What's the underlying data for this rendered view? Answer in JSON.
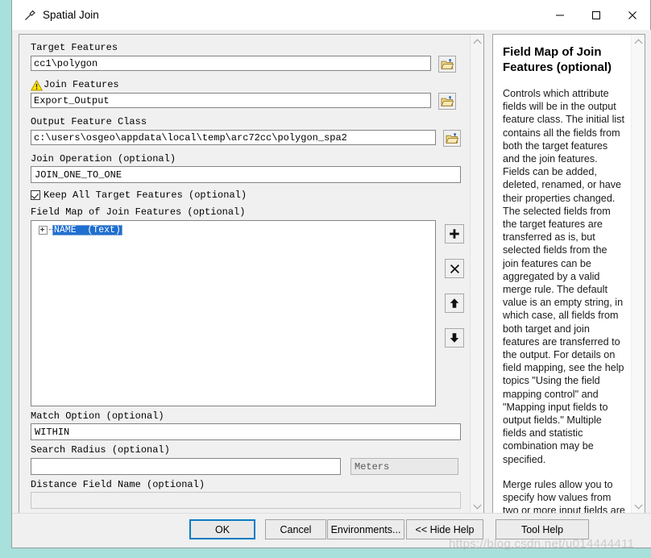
{
  "window": {
    "title": "Spatial Join",
    "icon": "hammer-icon",
    "controls": {
      "minimize": "─",
      "maximize": "□",
      "close": "✕"
    }
  },
  "params": {
    "target_features": {
      "label": "Target Features",
      "value": "cc1\\polygon",
      "browse": "folder-open-icon"
    },
    "join_features": {
      "label": "Join Features",
      "value": "Export_Output",
      "warning": "warning-icon",
      "browse": "folder-open-icon"
    },
    "output_feature_class": {
      "label": "Output Feature Class",
      "value": "c:\\users\\osgeo\\appdata\\local\\temp\\arc72cc\\polygon_spa2",
      "browse": "folder-open-icon"
    },
    "join_operation": {
      "label": "Join Operation (optional)",
      "value": "JOIN_ONE_TO_ONE"
    },
    "keep_all_target_features": {
      "label": "Keep All Target Features (optional)",
      "checked": true
    },
    "field_map": {
      "label": "Field Map of Join Features (optional)",
      "items": [
        {
          "name": "NAME  (Text)",
          "selected": true,
          "expandable": true
        }
      ],
      "buttons": [
        {
          "name": "add-field-button",
          "glyph": "+"
        },
        {
          "name": "delete-field-button",
          "glyph": "✕"
        },
        {
          "name": "move-up-button",
          "glyph": "↑"
        },
        {
          "name": "move-down-button",
          "glyph": "↓"
        }
      ]
    },
    "match_option": {
      "label": "Match Option (optional)",
      "value": "WITHIN"
    },
    "search_radius": {
      "label": "Search Radius (optional)",
      "value": "",
      "units_value": "Meters",
      "units_disabled": true
    },
    "distance_field_name": {
      "label": "Distance Field Name (optional)",
      "value": "",
      "disabled": true
    }
  },
  "help": {
    "title": "Field Map of Join Features (optional)",
    "paragraphs": [
      "Controls which attribute fields will be in the output feature class. The initial list contains all the fields from both the target features and the join features. Fields can be added, deleted, renamed, or have their properties changed. The selected fields from the target features are transferred as is, but selected fields from the join features can be aggregated by a valid merge rule. The default value is an empty string, in which case, all fields from both target and join features are transferred to the output. For details on field mapping, see the help topics \"Using the field mapping control\" and \"Mapping input fields to output fields.\" Multiple fields and statistic combination may be specified.",
      "Merge rules allow you to specify how values from two or more input fields are merged or combined into a single output value. There"
    ]
  },
  "footer": {
    "buttons": [
      {
        "name": "ok-button",
        "label": "OK",
        "default": true
      },
      {
        "name": "cancel-button",
        "label": "Cancel",
        "default": false
      },
      {
        "name": "environments-button",
        "label": "Environments...",
        "default": false
      },
      {
        "name": "hide-help-button",
        "label": "<< Hide Help",
        "default": false
      },
      {
        "name": "tool-help-button",
        "label": "Tool Help",
        "default": false
      }
    ]
  },
  "watermark": {
    "text": "https://blog.csdn.net/u014444411"
  }
}
